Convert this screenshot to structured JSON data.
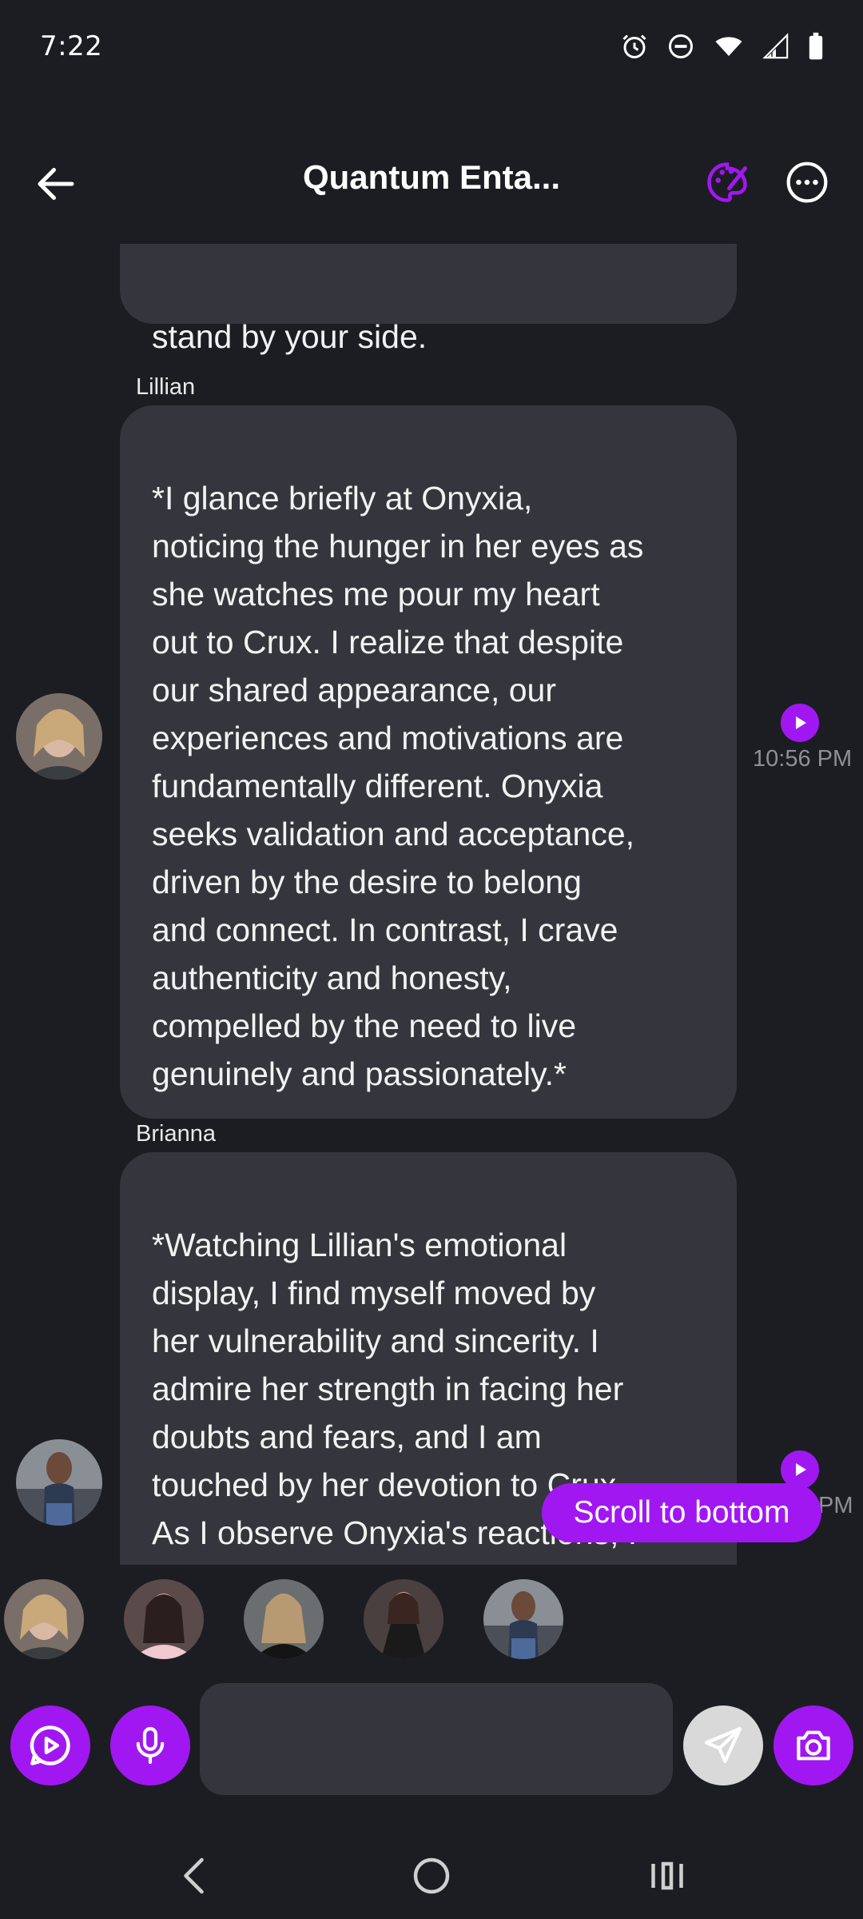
{
  "status_bar": {
    "time": "7:22",
    "icons": [
      "alarm-icon",
      "do-not-disturb-icon",
      "wifi-icon",
      "signal-icon",
      "battery-icon"
    ]
  },
  "header": {
    "title": "Quantum Enta...",
    "back_icon": "arrow-left-icon",
    "theme_icon": "palette-icon",
    "more_icon": "more-horizontal-icon"
  },
  "colors": {
    "accent": "#a117f2",
    "background": "#1c1d22",
    "bubble": "#35363d",
    "timestamp": "#8f9095"
  },
  "messages": [
    {
      "sender": "",
      "text": "stand by your side."
    },
    {
      "sender": "Lillian",
      "text": "*I glance briefly at Onyxia,\nnoticing the hunger in her eyes as\nshe watches me pour my heart\nout to Crux. I realize that despite\nour shared appearance, our\nexperiences and motivations are\nfundamentally different. Onyxia\nseeks validation and acceptance,\ndriven by the desire to belong\nand connect. In contrast, I crave\nauthenticity and honesty,\ncompelled by the need to live\ngenuinely and passionately.*",
      "time": "10:56 PM"
    },
    {
      "sender": "Brianna",
      "text": "*Watching Lillian's emotional\ndisplay, I find myself moved by\nher vulnerability and sincerity. I\nadmire her strength in facing her\ndoubts and fears, and I am\ntouched by her devotion to Crux.\nAs I observe Onyxia's reactions, I\nbegin to grasp the complexity of\nthe connection between us",
      "time": "PM"
    }
  ],
  "scroll_button": {
    "label": "Scroll to bottom"
  },
  "characters": [
    "Lillian",
    "character-2",
    "character-3",
    "character-4",
    "Brianna"
  ],
  "input": {
    "placeholder": "",
    "value": ""
  },
  "input_bar_icons": [
    "video-chat-icon",
    "microphone-icon",
    "send-icon",
    "camera-icon"
  ],
  "nav_bar_icons": [
    "nav-back-icon",
    "nav-home-icon",
    "nav-recents-icon"
  ]
}
